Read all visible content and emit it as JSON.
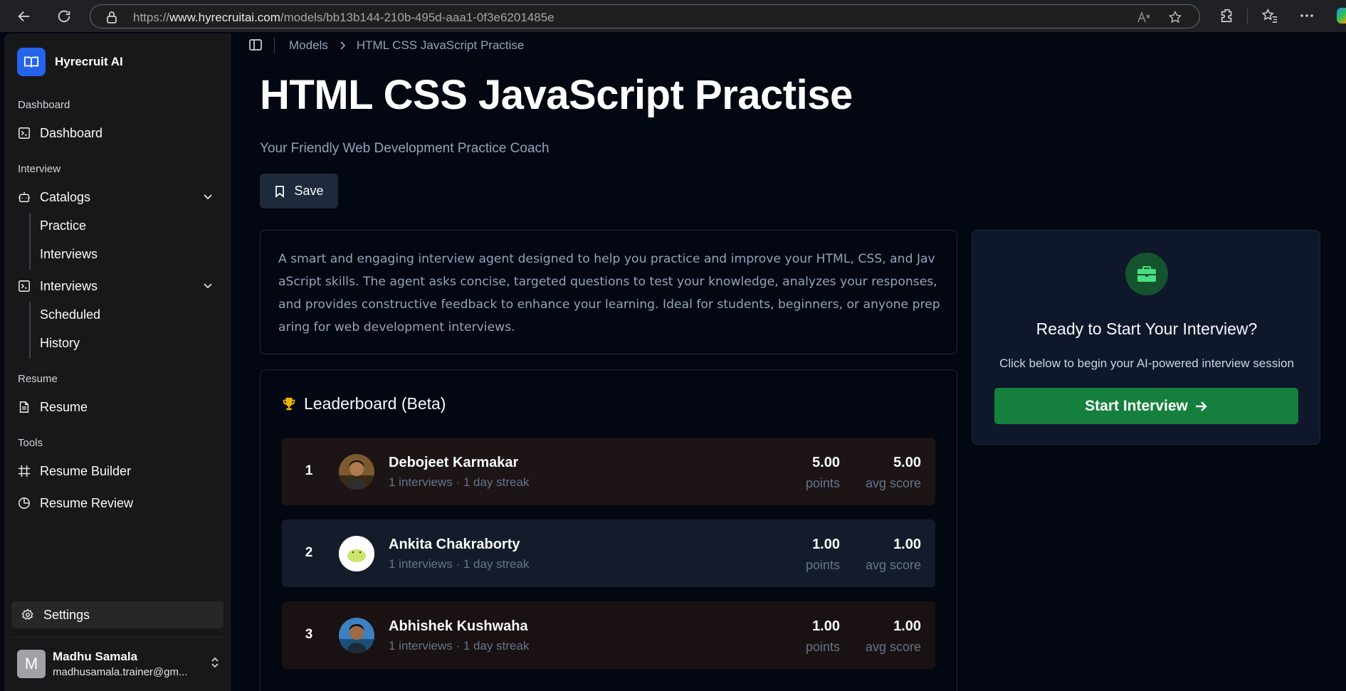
{
  "browser": {
    "url_prefix": "https://",
    "url_host": "www.hyrecruitai.com",
    "url_path": "/models/bb13b144-210b-495d-aaa1-0f3e6201485e"
  },
  "sidebar": {
    "brand": "Hyrecruit AI",
    "sections": {
      "dashboard": "Dashboard",
      "interview": "Interview",
      "resume": "Resume",
      "tools": "Tools"
    },
    "items": {
      "dashboard": "Dashboard",
      "catalogs": "Catalogs",
      "practice": "Practice",
      "interviews_sub": "Interviews",
      "interviews": "Interviews",
      "scheduled": "Scheduled",
      "history": "History",
      "resume": "Resume",
      "resume_builder": "Resume Builder",
      "resume_review": "Resume Review",
      "settings": "Settings"
    },
    "user": {
      "initial": "M",
      "name": "Madhu Samala",
      "email": "madhusamala.trainer@gm..."
    }
  },
  "breadcrumb": {
    "parent": "Models",
    "current": "HTML CSS JavaScript Practise"
  },
  "page": {
    "title": "HTML CSS JavaScript Practise",
    "subtitle": "Your Friendly Web Development Practice Coach",
    "save_label": "Save",
    "description": "A smart and engaging interview agent designed to help you practice and improve your HTML, CSS, and JavaScript skills. The agent asks concise, targeted questions to test your knowledge, analyzes your responses, and provides constructive feedback to enhance your learning. Ideal for students, beginners, or anyone preparing for web development interviews."
  },
  "leaderboard": {
    "title": "Leaderboard (Beta)",
    "points_label": "points",
    "avg_label": "avg score",
    "rows": [
      {
        "rank": "1",
        "name": "Debojeet Karmakar",
        "meta": "1 interviews · 1 day streak",
        "points": "5.00",
        "avg": "5.00"
      },
      {
        "rank": "2",
        "name": "Ankita Chakraborty",
        "meta": "1 interviews · 1 day streak",
        "points": "1.00",
        "avg": "1.00"
      },
      {
        "rank": "3",
        "name": "Abhishek Kushwaha",
        "meta": "1 interviews · 1 day streak",
        "points": "1.00",
        "avg": "1.00"
      }
    ]
  },
  "cta": {
    "title": "Ready to Start Your Interview?",
    "subtitle": "Click below to begin your AI-powered interview session",
    "button": "Start Interview"
  },
  "colors": {
    "accent_green": "#15803d",
    "brand_blue": "#2563eb",
    "trophy": "#eab308"
  }
}
